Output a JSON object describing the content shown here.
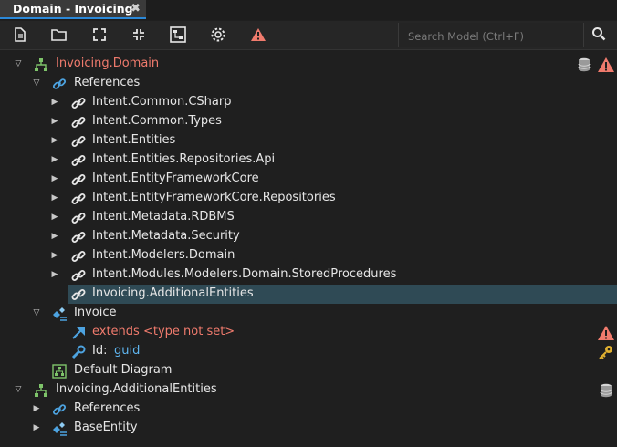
{
  "tab": {
    "title": "Domain - Invoicing*",
    "close": "✖"
  },
  "toolbar": {
    "buttons": [
      "new-file-icon",
      "open-folder-icon",
      "expand-icon",
      "collapse-icon",
      "diagram-icon",
      "settings-icon",
      "warning-icon"
    ]
  },
  "search": {
    "placeholder": "Search Model (Ctrl+F)"
  },
  "tree": {
    "root1": "Invoicing.Domain",
    "references": "References",
    "refs": [
      "Intent.Common.CSharp",
      "Intent.Common.Types",
      "Intent.Entities",
      "Intent.Entities.Repositories.Api",
      "Intent.EntityFrameworkCore",
      "Intent.EntityFrameworkCore.Repositories",
      "Intent.Metadata.RDBMS",
      "Intent.Metadata.Security",
      "Intent.Modelers.Domain",
      "Intent.Modules.Modelers.Domain.StoredProcedures",
      "Invoicing.AdditionalEntities"
    ],
    "invoice": "Invoice",
    "extends": "extends <type not set>",
    "id_label": "Id:",
    "id_type": "guid",
    "default_diagram": "Default Diagram",
    "root2": "Invoicing.AdditionalEntities",
    "references2": "References",
    "base_entity": "BaseEntity"
  },
  "colors": {
    "accent": "#2b88d8",
    "error": "#f07b6d",
    "type": "#5fb6f0",
    "selected": "#2f4a55"
  }
}
